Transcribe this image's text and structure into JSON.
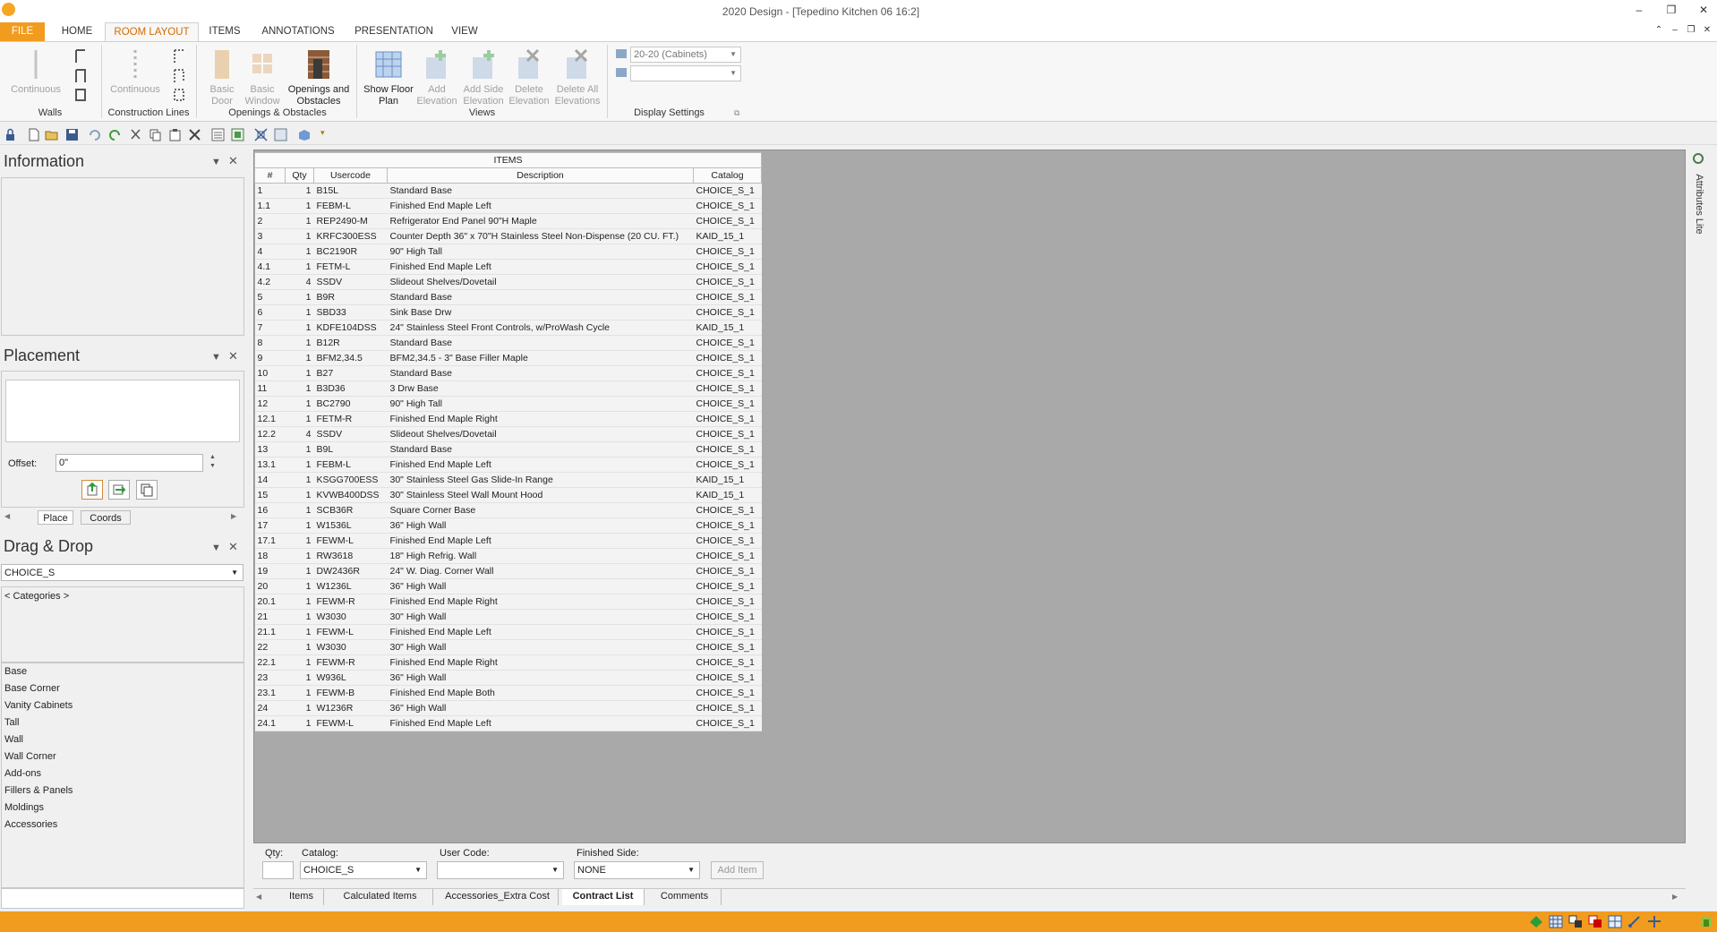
{
  "window": {
    "title": "2020 Design - [Tepedino Kitchen 06 16:2]",
    "controls": [
      "–",
      "❐",
      "✕"
    ],
    "doc_controls": [
      "⌃",
      "–",
      "❐",
      "✕"
    ]
  },
  "ribbon_tabs": [
    "FILE",
    "HOME",
    "ROOM LAYOUT",
    "ITEMS",
    "ANNOTATIONS",
    "PRESENTATION",
    "VIEW"
  ],
  "ribbon": {
    "walls": {
      "label": "Walls",
      "continuous": "Continuous"
    },
    "construction": {
      "label": "Construction Lines",
      "continuous": "Continuous"
    },
    "openings": {
      "label": "Openings & Obstacles",
      "basic_door": "Basic Door",
      "basic_window": "Basic Window",
      "openings_obstacles": "Openings and Obstacles"
    },
    "views": {
      "label": "Views",
      "show_floor_plan": "Show Floor Plan",
      "add_elevation": "Add Elevation",
      "add_side_elevation": "Add Side Elevation",
      "delete_elevation": "Delete Elevation",
      "delete_all_elevations": "Delete All Elevations"
    },
    "display": {
      "label": "Display Settings",
      "combo1": "20-20 (Cabinets)",
      "combo2": ""
    }
  },
  "panes": {
    "information": {
      "title": "Information"
    },
    "placement": {
      "title": "Placement",
      "offset_label": "Offset:",
      "offset_value": "0\"",
      "tabs": [
        "Place",
        "Coords"
      ]
    },
    "dragdrop": {
      "title": "Drag & Drop",
      "catalog": "CHOICE_S",
      "breadcrumb": "< Categories >",
      "categories": [
        "Base",
        "Base Corner",
        "Vanity Cabinets",
        "Tall",
        "Wall",
        "Wall Corner",
        "Add-ons",
        "Fillers & Panels",
        "Moldings",
        "Accessories"
      ]
    }
  },
  "grid": {
    "title": "ITEMS",
    "headers": [
      "#",
      "Qty",
      "Usercode",
      "Description",
      "Catalog"
    ],
    "rows": [
      [
        "1",
        "1",
        "B15L",
        "Standard Base",
        "CHOICE_S_1"
      ],
      [
        "1.1",
        "1",
        "FEBM-L",
        "Finished End Maple Left",
        "CHOICE_S_1"
      ],
      [
        "2",
        "1",
        "REP2490-M",
        "Refrigerator End Panel 90\"H Maple",
        "CHOICE_S_1"
      ],
      [
        "3",
        "1",
        "KRFC300ESS",
        "Counter Depth 36\" x 70\"H Stainless Steel Non-Dispense (20 CU. FT.)",
        "KAID_15_1"
      ],
      [
        "4",
        "1",
        "BC2190R",
        "90\" High Tall",
        "CHOICE_S_1"
      ],
      [
        "4.1",
        "1",
        "FETM-L",
        "Finished End Maple Left",
        "CHOICE_S_1"
      ],
      [
        "4.2",
        "4",
        "SSDV",
        "Slideout Shelves/Dovetail",
        "CHOICE_S_1"
      ],
      [
        "5",
        "1",
        "B9R",
        "Standard Base",
        "CHOICE_S_1"
      ],
      [
        "6",
        "1",
        "SBD33",
        "Sink Base Drw",
        "CHOICE_S_1"
      ],
      [
        "7",
        "1",
        "KDFE104DSS",
        "24\" Stainless Steel Front Controls, w/ProWash Cycle",
        "KAID_15_1"
      ],
      [
        "8",
        "1",
        "B12R",
        "Standard Base",
        "CHOICE_S_1"
      ],
      [
        "9",
        "1",
        "BFM2,34.5",
        "BFM2,34.5 - 3\" Base Filler Maple",
        "CHOICE_S_1"
      ],
      [
        "10",
        "1",
        "B27",
        "Standard Base",
        "CHOICE_S_1"
      ],
      [
        "11",
        "1",
        "B3D36",
        "3 Drw Base",
        "CHOICE_S_1"
      ],
      [
        "12",
        "1",
        "BC2790",
        "90\" High Tall",
        "CHOICE_S_1"
      ],
      [
        "12.1",
        "1",
        "FETM-R",
        "Finished End Maple Right",
        "CHOICE_S_1"
      ],
      [
        "12.2",
        "4",
        "SSDV",
        "Slideout Shelves/Dovetail",
        "CHOICE_S_1"
      ],
      [
        "13",
        "1",
        "B9L",
        "Standard Base",
        "CHOICE_S_1"
      ],
      [
        "13.1",
        "1",
        "FEBM-L",
        "Finished End Maple Left",
        "CHOICE_S_1"
      ],
      [
        "14",
        "1",
        "KSGG700ESS",
        "30\" Stainless Steel Gas Slide-In Range",
        "KAID_15_1"
      ],
      [
        "15",
        "1",
        "KVWB400DSS",
        "30\" Stainless Steel Wall Mount Hood",
        "KAID_15_1"
      ],
      [
        "16",
        "1",
        "SCB36R",
        "Square Corner Base",
        "CHOICE_S_1"
      ],
      [
        "17",
        "1",
        "W1536L",
        "36\" High Wall",
        "CHOICE_S_1"
      ],
      [
        "17.1",
        "1",
        "FEWM-L",
        "Finished End Maple Left",
        "CHOICE_S_1"
      ],
      [
        "18",
        "1",
        "RW3618",
        "18\" High Refrig. Wall",
        "CHOICE_S_1"
      ],
      [
        "19",
        "1",
        "DW2436R",
        "24\" W. Diag. Corner Wall",
        "CHOICE_S_1"
      ],
      [
        "20",
        "1",
        "W1236L",
        "36\" High Wall",
        "CHOICE_S_1"
      ],
      [
        "20.1",
        "1",
        "FEWM-R",
        "Finished End Maple Right",
        "CHOICE_S_1"
      ],
      [
        "21",
        "1",
        "W3030",
        "30\" High Wall",
        "CHOICE_S_1"
      ],
      [
        "21.1",
        "1",
        "FEWM-L",
        "Finished End Maple Left",
        "CHOICE_S_1"
      ],
      [
        "22",
        "1",
        "W3030",
        "30\" High Wall",
        "CHOICE_S_1"
      ],
      [
        "22.1",
        "1",
        "FEWM-R",
        "Finished End Maple Right",
        "CHOICE_S_1"
      ],
      [
        "23",
        "1",
        "W936L",
        "36\" High Wall",
        "CHOICE_S_1"
      ],
      [
        "23.1",
        "1",
        "FEWM-B",
        "Finished End Maple Both",
        "CHOICE_S_1"
      ],
      [
        "24",
        "1",
        "W1236R",
        "36\" High Wall",
        "CHOICE_S_1"
      ],
      [
        "24.1",
        "1",
        "FEWM-L",
        "Finished End Maple Left",
        "CHOICE_S_1"
      ]
    ]
  },
  "addbar": {
    "qty_label": "Qty:",
    "qty_value": "",
    "catalog_label": "Catalog:",
    "catalog_value": "CHOICE_S",
    "usercode_label": "User Code:",
    "usercode_value": "",
    "finished_label": "Finished Side:",
    "finished_value": "NONE",
    "add_button": "Add Item"
  },
  "sheet_tabs": [
    "Items",
    "Calculated Items",
    "Accessories_Extra Cost",
    "Contract List",
    "Comments"
  ],
  "side_tab": "Attributes Lite",
  "colors": {
    "accent": "#f29c1f",
    "tab_active": "#d36b00"
  }
}
